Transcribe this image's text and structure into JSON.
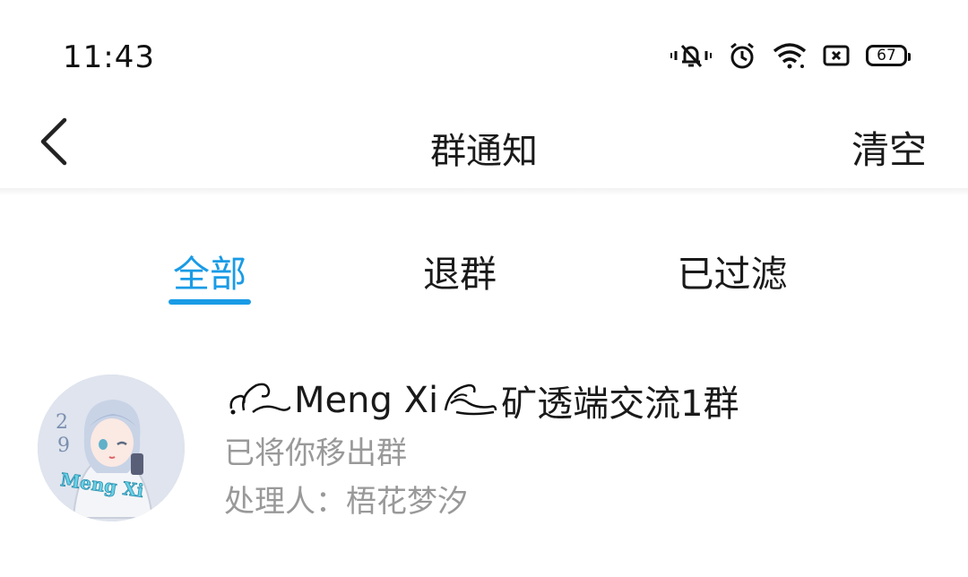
{
  "status_bar": {
    "time": "11:43",
    "battery": "67",
    "icons": [
      "vibrate-mute-icon",
      "alarm-icon",
      "wifi-icon",
      "sim-absent-icon",
      "battery-icon"
    ]
  },
  "header": {
    "title": "群通知",
    "clear_label": "清空",
    "back_icon": "chevron-left-icon"
  },
  "tabs": [
    {
      "label": "全部",
      "active": true
    },
    {
      "label": "退群",
      "active": false
    },
    {
      "label": "已过滤",
      "active": false
    }
  ],
  "notices": [
    {
      "group_prefix": "Meng Xi",
      "group_suffix": "矿透端交流1群",
      "message": "已将你移出群",
      "handler": "处理人：梧花梦汐",
      "avatar_text": "Meng Xi"
    }
  ],
  "colors": {
    "accent": "#1a9be6",
    "secondary_text": "#999999",
    "primary_text": "#1a1a1a"
  }
}
